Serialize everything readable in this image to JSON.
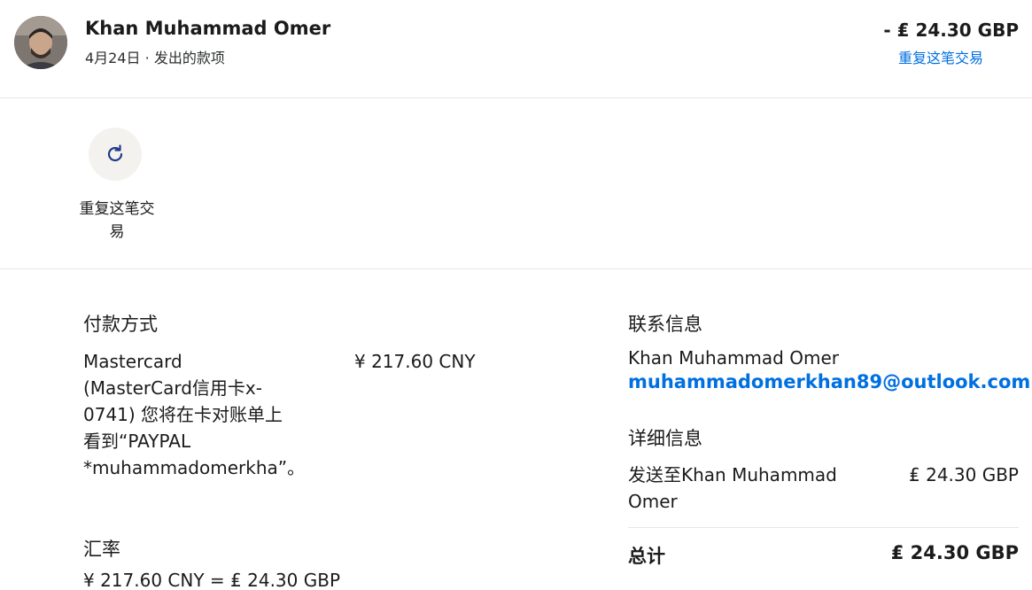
{
  "header": {
    "name": "Khan Muhammad Omer",
    "date": "4月24日",
    "separator": "·",
    "type": "发出的款项",
    "amount": "- ₤ 24.30 GBP",
    "repeat_link": "重复这笔交易"
  },
  "actions": {
    "repeat_label": "重复这笔交易",
    "repeat_icon": "refresh-icon"
  },
  "payment": {
    "title": "付款方式",
    "description": "Mastercard (MasterCard信用卡x-0741) 您将在卡对账单上看到“PAYPAL *muhammadomerkha”。",
    "amount": "¥ 217.60 CNY"
  },
  "exchange": {
    "title": "汇率",
    "value": "¥ 217.60 CNY = ₤ 24.30 GBP"
  },
  "contact": {
    "title": "联系信息",
    "name": "Khan Muhammad Omer",
    "email": "muhammadomerkhan89@outlook.com"
  },
  "details": {
    "title": "详细信息",
    "sent_to": "发送至Khan Muhammad Omer",
    "amount": "₤ 24.30 GBP",
    "total_label": "总计",
    "total_amount": "₤ 24.30 GBP"
  },
  "colors": {
    "link": "#0070e0",
    "icon": "#1f3a8a",
    "action_bg": "#f4f2ee"
  }
}
